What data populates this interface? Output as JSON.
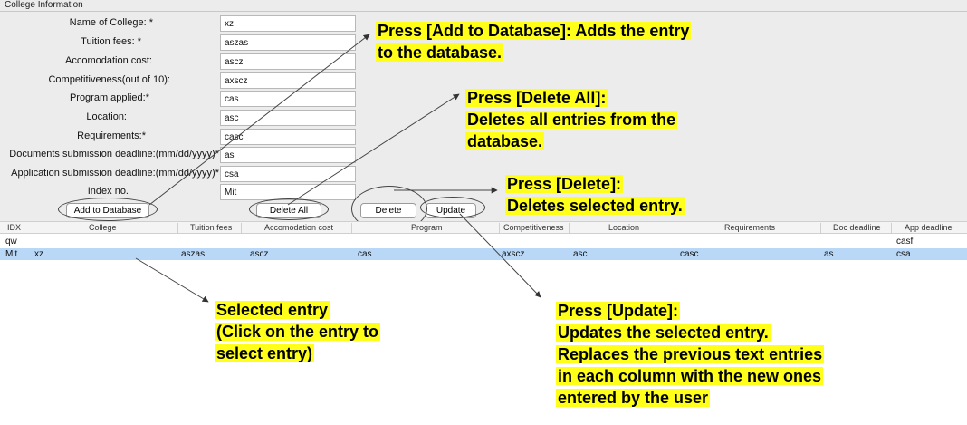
{
  "panel": {
    "title": "College Information"
  },
  "form": {
    "fields": [
      {
        "label": "Name of College: *",
        "value": "xz"
      },
      {
        "label": "Tuition fees: *",
        "value": "aszas"
      },
      {
        "label": "Accomodation cost:",
        "value": "ascz"
      },
      {
        "label": "Competitiveness(out of 10):",
        "value": "axscz"
      },
      {
        "label": "Program applied:*",
        "value": "cas"
      },
      {
        "label": "Location:",
        "value": "asc"
      },
      {
        "label": "Requirements:*",
        "value": "casc"
      },
      {
        "label": "Documents submission deadline:(mm/dd/yyyy)*",
        "value": "as"
      },
      {
        "label": "Application submission deadline:(mm/dd/yyyy)*",
        "value": "csa"
      },
      {
        "label": "Index no.",
        "value": "Mit"
      }
    ]
  },
  "buttons": {
    "add": "Add to Database",
    "delete_all": "Delete All",
    "delete": "Delete",
    "update": "Update"
  },
  "table": {
    "columns": [
      "IDX",
      "College",
      "Tuition fees",
      "Accomodation cost",
      "Program",
      "Competitiveness",
      "Location",
      "Requirements",
      "Doc deadline",
      "App deadline"
    ],
    "rows": [
      {
        "idx": "qw",
        "college": "",
        "tuition": "",
        "accom": "",
        "program": "",
        "comp": "",
        "location": "",
        "req": "",
        "doc": "",
        "app": "casf",
        "selected": false
      },
      {
        "idx": "Mit",
        "college": "xz",
        "tuition": "aszas",
        "accom": "ascz",
        "program": "cas",
        "comp": "axscz",
        "location": "asc",
        "req": "casc",
        "doc": "as",
        "app": "csa",
        "selected": true
      }
    ]
  },
  "annotations": {
    "add": [
      "Press [Add to Database]: Adds the entry",
      "to the database."
    ],
    "delete_all": [
      "Press [Delete All]:",
      "Deletes all entries from the",
      "database."
    ],
    "delete": [
      "Press [Delete]:",
      "Deletes selected entry."
    ],
    "selected": [
      "Selected entry",
      "(Click on the entry to",
      "select entry)"
    ],
    "update": [
      "Press [Update]:",
      "Updates the selected entry.",
      "Replaces the previous text entries",
      "in each column with the new ones",
      "entered by the user"
    ]
  },
  "colors": {
    "highlight": "#ffff1a",
    "selected_row": "#b9d8f7",
    "panel_bg": "#ececec"
  }
}
